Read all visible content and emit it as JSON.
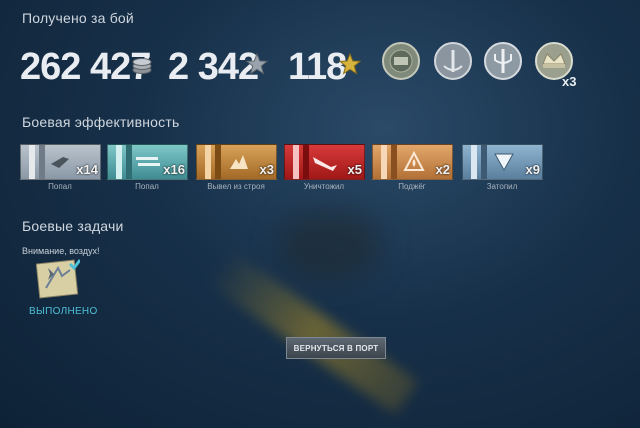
{
  "battle": {
    "title": "Получено за бой",
    "credits": "262 427",
    "xp": "2 342",
    "free_xp": "118",
    "medals": [
      {
        "icon": "seal-medal-icon"
      },
      {
        "icon": "anchor-wreath-medal-icon"
      },
      {
        "icon": "trident-medal-icon"
      },
      {
        "icon": "crown-medal-icon",
        "count": "x3"
      }
    ]
  },
  "efficiency": {
    "title": "Боевая эффективность",
    "ribbons": [
      {
        "label": "Попал",
        "count": "x14",
        "icon": "shell-hit-icon",
        "color": "#9fadb9"
      },
      {
        "label": "Попал",
        "count": "x16",
        "icon": "torpedo-hit-icon",
        "color": "#4fa3a8"
      },
      {
        "label": "Вывел из строя",
        "count": "x3",
        "icon": "incapacitation-icon",
        "color": "#c4873c"
      },
      {
        "label": "Уничтожил",
        "count": "x5",
        "icon": "destroyed-ship-icon",
        "color": "#c62828"
      },
      {
        "label": "Поджёг",
        "count": "x2",
        "icon": "fire-icon",
        "color": "#cf8a4a"
      },
      {
        "label": "Затопил",
        "count": "x9",
        "icon": "flooding-icon",
        "color": "#7599b6"
      }
    ]
  },
  "tasks": {
    "title": "Боевые задачи",
    "task_name": "Внимание, воздух!",
    "task_status": "ВЫПОЛНЕНО",
    "task_icon": "aircraft-map-icon"
  },
  "actions": {
    "return_label": "ВЕРНУТЬСЯ В ПОРТ"
  },
  "colors": {
    "accent": "#4ec0d8",
    "destroyed": "#c62828"
  }
}
